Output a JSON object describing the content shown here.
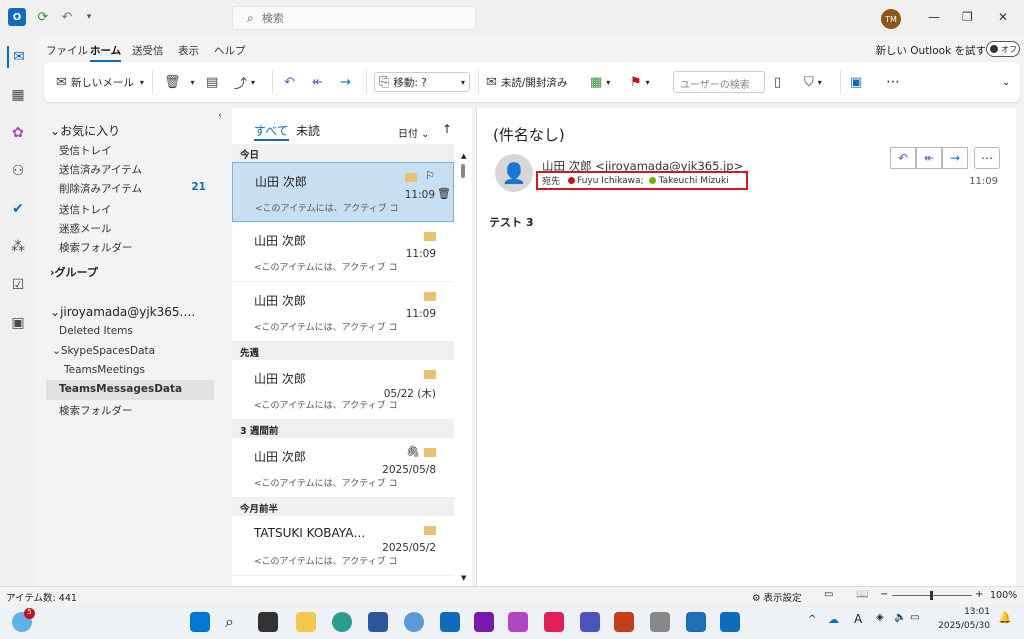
{
  "titlebar": {
    "search_placeholder": "検索",
    "avatar": "TM"
  },
  "menu": [
    "ファイル",
    "ホーム",
    "送受信",
    "表示",
    "ヘルプ"
  ],
  "menu_active": "ホーム",
  "try_outlook": "新しい Outlook を試す",
  "toggle": "オフ",
  "ribbon": {
    "new_mail": "新しいメール",
    "move": "移動: ?",
    "read_unread": "未読/開封済み",
    "user_search": "ユーザーの検索"
  },
  "folders": {
    "favorites": "お気に入り",
    "fav_items": [
      "受信トレイ",
      "送信済みアイテム",
      "削除済みアイテム"
    ],
    "deleted_count": "21",
    "other_items": [
      "送信トレイ",
      "迷惑メール",
      "検索フォルダー"
    ],
    "groups": "グループ",
    "account": "jiroyamada@yjk365.…",
    "acc_items": [
      "Deleted Items",
      "SkypeSpacesData",
      "TeamsMeetings",
      "TeamsMessagesData",
      "検索フォルダー"
    ]
  },
  "list": {
    "tab_all": "すべて",
    "tab_unread": "未読",
    "sort": "日付",
    "groups": [
      "今日",
      "先週",
      "3 週間前",
      "今月前半"
    ],
    "mails": [
      {
        "from": "山田 次郎",
        "preview": "<このアイテムには、アクティブ コ",
        "time": "11:09"
      },
      {
        "from": "山田 次郎",
        "preview": "<このアイテムには、アクティブ コ",
        "time": "11:09"
      },
      {
        "from": "山田 次郎",
        "preview": "<このアイテムには、アクティブ コ",
        "time": "11:09"
      },
      {
        "from": "山田 次郎",
        "preview": "<このアイテムには、アクティブ コ",
        "time": "05/22 (木)"
      },
      {
        "from": "山田 次郎",
        "preview": "<このアイテムには、アクティブ コ",
        "time": "2025/05/8"
      },
      {
        "from": "TATSUKI KOBAYA…",
        "preview": "<このアイテムには、アクティブ コ",
        "time": "2025/05/2"
      }
    ]
  },
  "reading": {
    "subject": "(件名なし)",
    "sender": "山田 次郎 <jiroyamada@yjk365.jp>",
    "to_label": "宛先",
    "recipient1": "Fuyu Ichikawa;",
    "recipient2": "Takeuchi Mizuki",
    "time": "11:09",
    "body": "テスト 3"
  },
  "status": {
    "items": "アイテム数: 441",
    "view_settings": "表示設定",
    "zoom": "100%"
  },
  "taskbar": {
    "time": "13:01",
    "date": "2025/05/30",
    "badge": "5"
  },
  "colors": {
    "accent": "#0f6cbd",
    "highlight": "#d11a1a",
    "sel": "#c7dff3",
    "dot1": "#c50f1f",
    "dot2": "#6bb700"
  }
}
